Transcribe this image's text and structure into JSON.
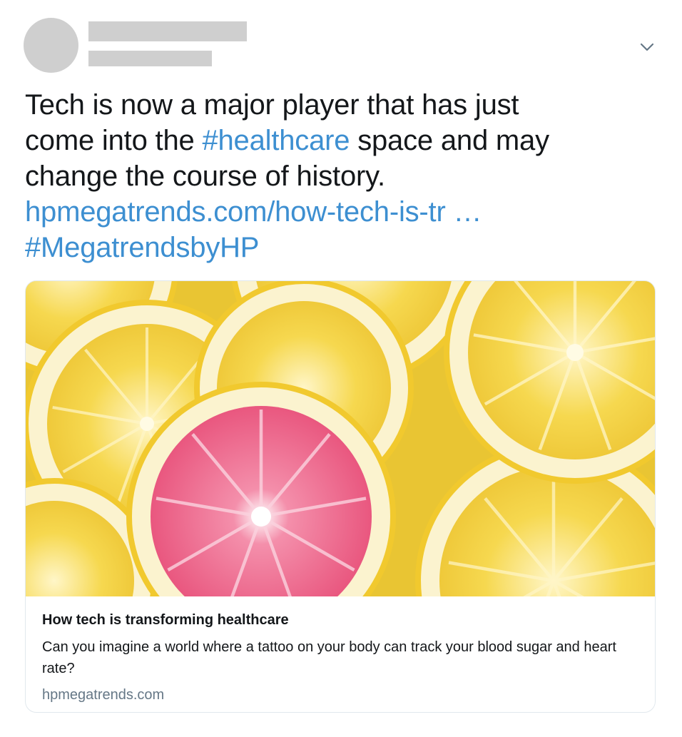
{
  "tweet": {
    "text_before_hashtag": "Tech is now a major player that has just come into the ",
    "hashtag_1": "#healthcare",
    "text_after_hashtag": " space and may change the course of history.",
    "link": "hpmegatrends.com/how-tech-is-tr …",
    "hashtag_2": "#MegatrendsbyHP"
  },
  "card": {
    "title": "How tech is transforming healthcare",
    "description": "Can you imagine a world where a tattoo on your body can track your blood sugar and heart rate?",
    "domain": "hpmegatrends.com",
    "image_icon": "lemon-slices-image"
  },
  "icons": {
    "menu": "chevron-down-icon"
  },
  "colors": {
    "link": "#3d8fd1",
    "text": "#14171a",
    "muted": "#657786",
    "redacted": "#cfcfcf",
    "lemon_yellow": "#f2d54a",
    "grapefruit_pink": "#ec6a8e"
  }
}
